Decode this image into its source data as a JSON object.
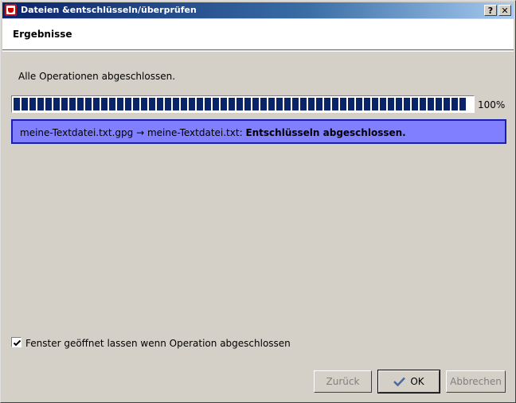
{
  "window": {
    "title": "Dateien &entschlüsseln/überprüfen",
    "help_button": "?",
    "close_button": "✕"
  },
  "header": {
    "title": "Ergebnisse"
  },
  "main": {
    "status_text": "Alle Operationen abgeschlossen.",
    "progress": {
      "value": 100,
      "label": "100%"
    },
    "results": [
      {
        "prefix": "meine-Textdatei.txt.gpg → meine-Textdatei.txt: ",
        "message": "Entschlüsseln abgeschlossen."
      }
    ]
  },
  "options": {
    "keep_open_checked": true,
    "keep_open_label": "Fenster geöffnet lassen wenn Operation abgeschlossen"
  },
  "buttons": {
    "back": "Zurück",
    "ok": "OK",
    "cancel": "Abbrechen"
  },
  "colors": {
    "titlebar": "#0a246a",
    "progress": "#0a246a",
    "result_bg": "#7f7fff",
    "result_border": "#1b1fb0"
  }
}
